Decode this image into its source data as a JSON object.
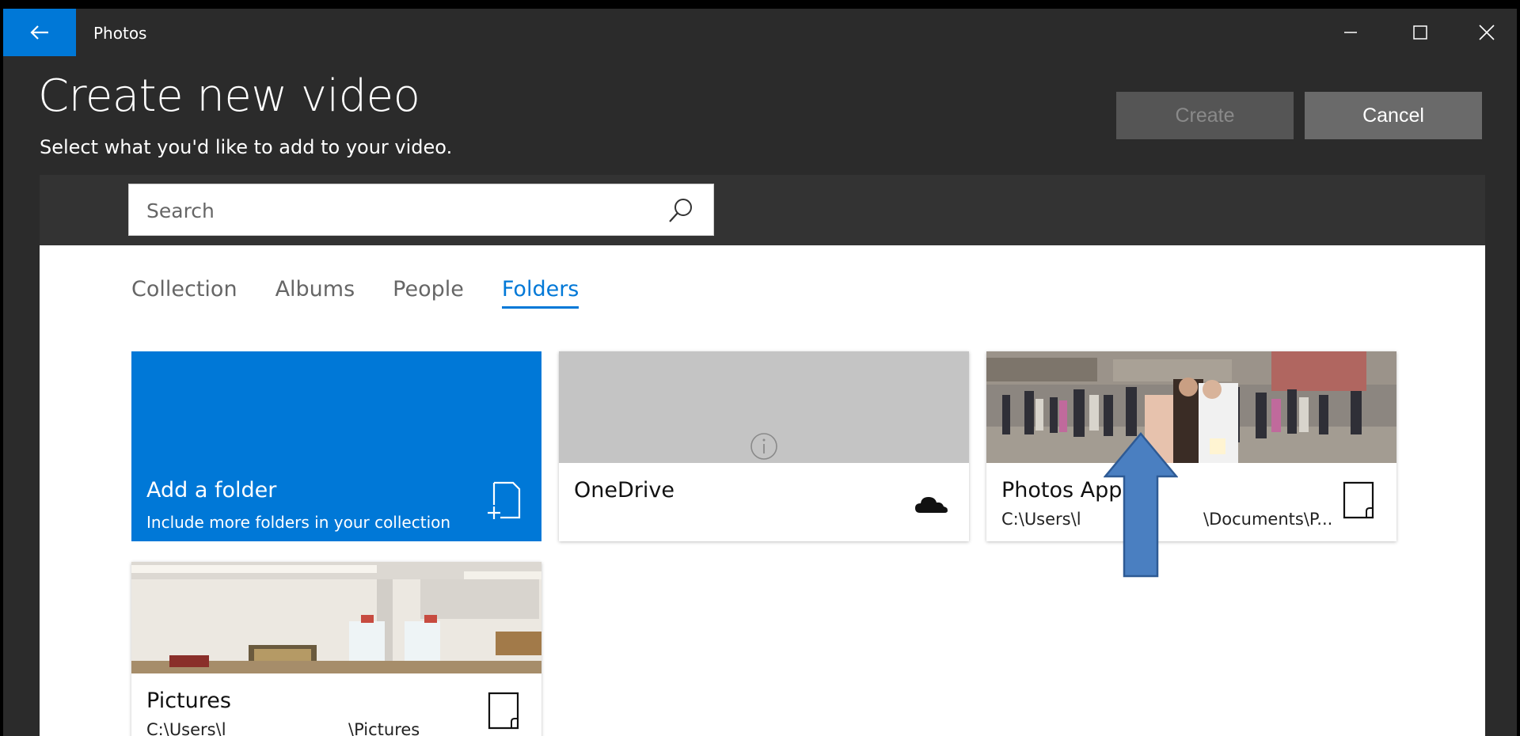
{
  "window": {
    "app_title": "Photos",
    "back_icon": "back-arrow-icon",
    "controls": [
      "minimize-icon",
      "maximize-icon",
      "close-icon"
    ]
  },
  "header": {
    "title": "Create new video",
    "subtitle": "Select what you'd like to add to your video.",
    "create_label": "Create",
    "cancel_label": "Cancel"
  },
  "search": {
    "placeholder": "Search",
    "value": ""
  },
  "tabs": [
    {
      "label": "Collection",
      "active": false
    },
    {
      "label": "Albums",
      "active": false
    },
    {
      "label": "People",
      "active": false
    },
    {
      "label": "Folders",
      "active": true
    }
  ],
  "folders": {
    "add": {
      "name": "Add a folder",
      "description": "Include more folders in your collection"
    },
    "onedrive": {
      "name": "OneDrive"
    },
    "photos_app": {
      "name": "Photos App",
      "path_left": "C:\\Users\\l",
      "path_right": "\\Documents\\P..."
    },
    "pictures": {
      "name": "Pictures",
      "path_left": "C:\\Users\\l",
      "path_right": "\\Pictures"
    }
  },
  "colors": {
    "accent": "#0078d7",
    "window_bg": "#2b2b2b",
    "annotation_arrow": "#4a7fc1"
  }
}
